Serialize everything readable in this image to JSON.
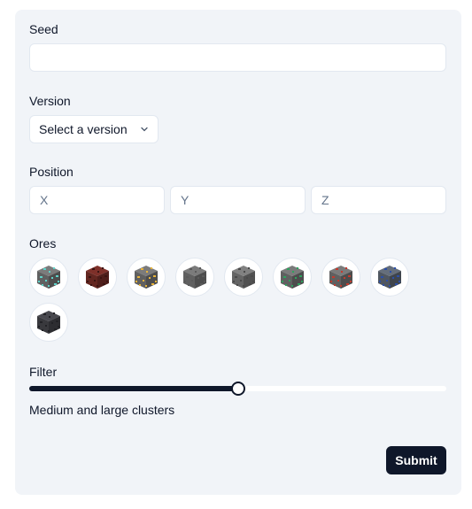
{
  "seed": {
    "label": "Seed",
    "value": "",
    "placeholder": ""
  },
  "version": {
    "label": "Version",
    "selected": "Select a version"
  },
  "position": {
    "label": "Position",
    "x_placeholder": "X",
    "y_placeholder": "Y",
    "z_placeholder": "Z"
  },
  "ores": {
    "label": "Ores",
    "items": [
      {
        "icon": "diamond-ore-icon",
        "base": "#6b6b6b",
        "speck": "#5fd3c9"
      },
      {
        "icon": "nether-quartz-ore-icon",
        "base": "#6e2a24",
        "speck": "#3a1512"
      },
      {
        "icon": "gold-ore-icon",
        "base": "#6b6b6b",
        "speck": "#e8b33a"
      },
      {
        "icon": "iron-ore-icon",
        "base": "#6b6b6b",
        "speck": "#5a5a5a"
      },
      {
        "icon": "coal-ore-icon",
        "base": "#707070",
        "speck": "#4a4a4a"
      },
      {
        "icon": "emerald-ore-icon",
        "base": "#6b6b6b",
        "speck": "#2fa25e"
      },
      {
        "icon": "redstone-ore-icon",
        "base": "#6b6b6b",
        "speck": "#c43a2e"
      },
      {
        "icon": "lapis-ore-icon",
        "base": "#58606b",
        "speck": "#2c4fa8"
      },
      {
        "icon": "deepslate-ore-icon",
        "base": "#3f3f44",
        "speck": "#222226"
      }
    ]
  },
  "filter": {
    "label": "Filter",
    "level_fraction": 0.5,
    "description": "Medium and large clusters"
  },
  "submit": {
    "label": "Submit"
  },
  "colors": {
    "accent": "#0f172a",
    "card": "#f1f4f8",
    "border": "#e2e8f0"
  }
}
